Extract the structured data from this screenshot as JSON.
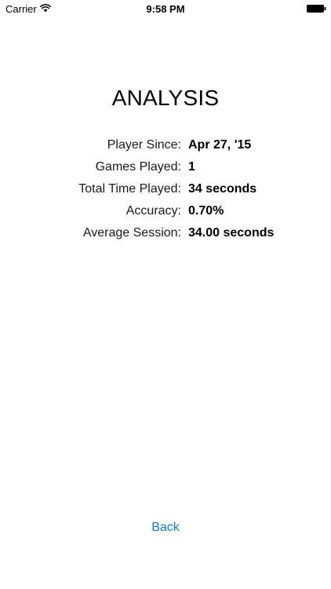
{
  "status_bar": {
    "carrier": "Carrier",
    "time": "9:58 PM",
    "wifi_icon": "wifi-icon",
    "battery_icon": "battery-full-icon"
  },
  "title": "ANALYSIS",
  "stats": [
    {
      "label": "Player Since:",
      "value": "Apr 27, '15"
    },
    {
      "label": "Games Played:",
      "value": "1"
    },
    {
      "label": "Total Time Played:",
      "value": "34 seconds"
    },
    {
      "label": "Accuracy:",
      "value": "0.70%"
    },
    {
      "label": "Average Session:",
      "value": "34.00 seconds"
    }
  ],
  "back_button": {
    "label": "Back",
    "color": "#1478d4"
  }
}
